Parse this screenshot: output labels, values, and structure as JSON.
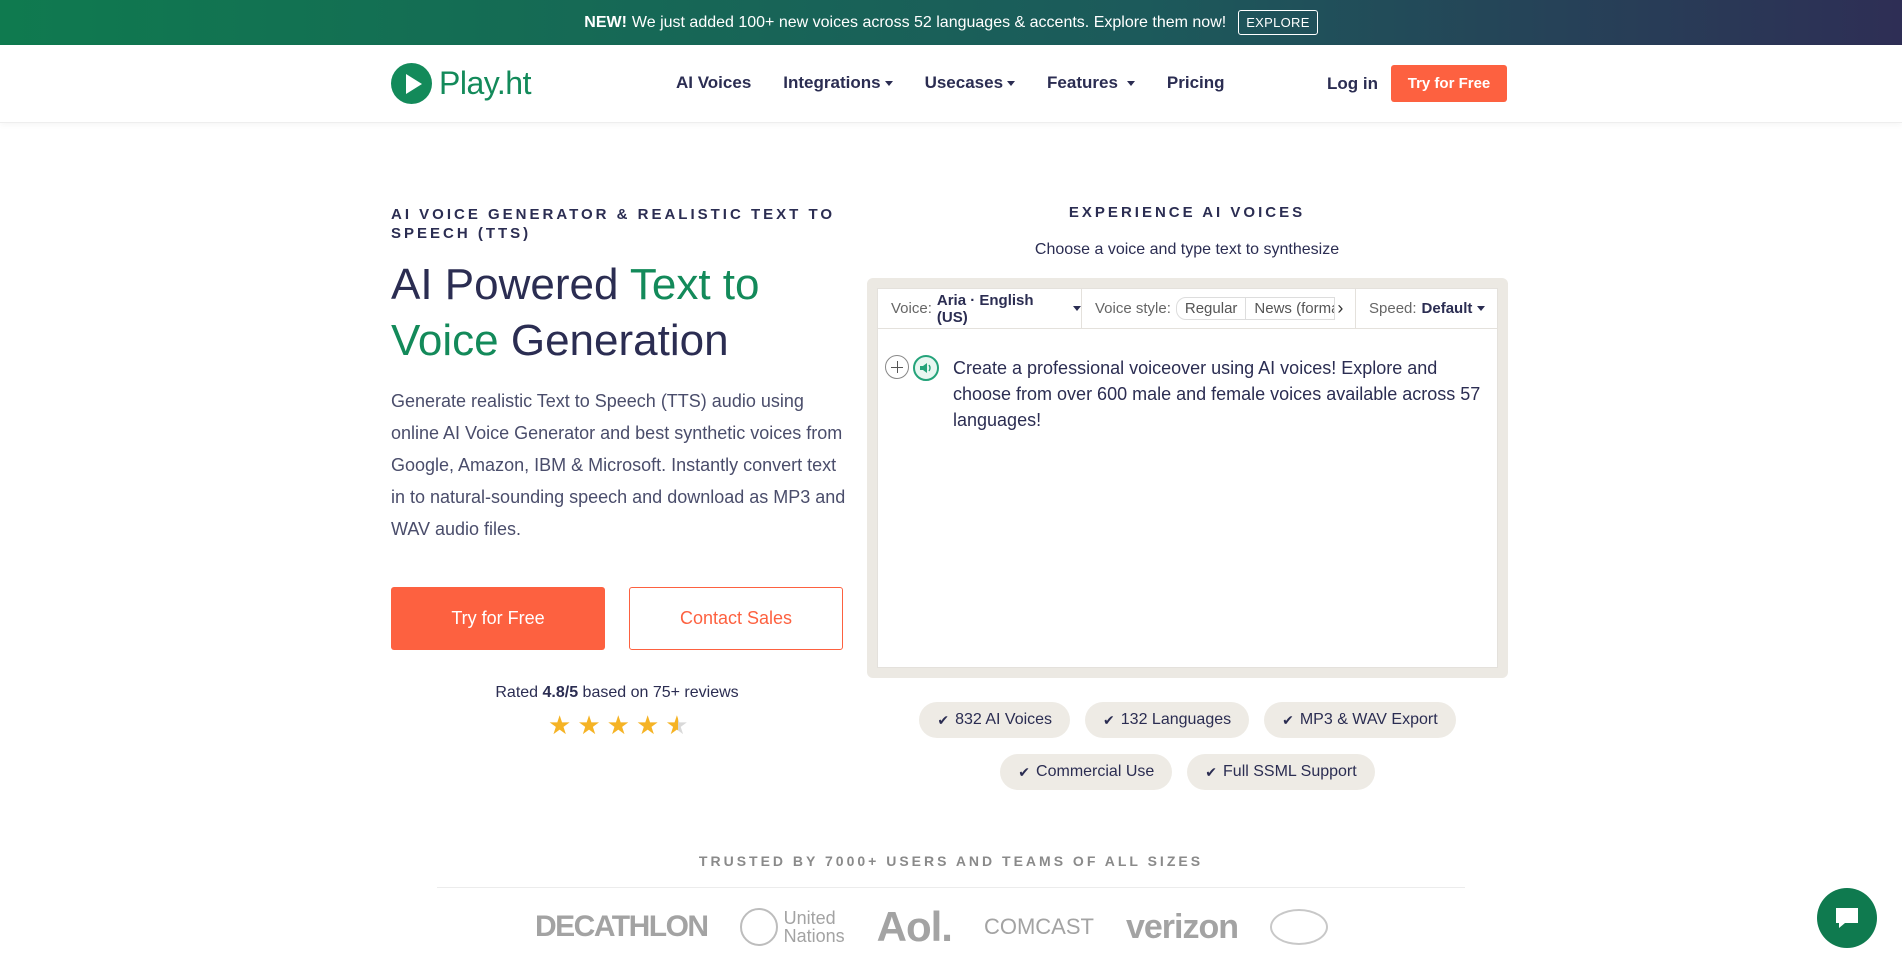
{
  "banner": {
    "new_label": "NEW!",
    "text": "We just added 100+ new voices across 52 languages & accents. Explore them now!",
    "cta": "EXPLORE"
  },
  "nav": {
    "logo": "Play.ht",
    "links": [
      "AI Voices",
      "Integrations",
      "Usecases",
      "Features",
      "Pricing"
    ],
    "login": "Log in",
    "try": "Try for Free"
  },
  "hero": {
    "eyebrow": "AI VOICE GENERATOR & REALISTIC TEXT TO SPEECH (TTS)",
    "headline_1": "AI Powered ",
    "headline_2": "Text to Voice",
    "headline_3": " Generation",
    "description": "Generate realistic Text to Speech (TTS) audio using online AI Voice Generator and best synthetic voices from Google, Amazon, IBM & Microsoft. Instantly convert text in to natural-sounding speech and download as MP3 and WAV audio files.",
    "primary_cta": "Try for Free",
    "secondary_cta": "Contact Sales",
    "rating_prefix": "Rated ",
    "rating_value": "4.8/5",
    "rating_suffix": " based on 75+ reviews",
    "stars": 4.5
  },
  "experience": {
    "title": "EXPERIENCE AI VOICES",
    "subtitle": "Choose a voice and type text to synthesize",
    "voice_label": "Voice:",
    "voice_value": "Aria · English (US)",
    "style_label": "Voice style:",
    "styles": [
      "Regular",
      "News (formal)"
    ],
    "speed_label": "Speed:",
    "speed_value": "Default",
    "text": "Create a professional voiceover using AI voices! Explore and choose from over 600 male and female voices available across 57 languages!"
  },
  "features": [
    "832 AI Voices",
    "132 Languages",
    "MP3 & WAV Export",
    "Commercial Use",
    "Full SSML Support"
  ],
  "trusted": {
    "title": "TRUSTED BY 7000+ USERS AND TEAMS OF ALL SIZES",
    "logos": [
      "DECATHLON",
      "United",
      "Nations",
      "Aol.",
      "COMCAST",
      "verizon"
    ]
  },
  "colors": {
    "brand_green": "#138a5a",
    "accent_orange": "#fd6140"
  }
}
